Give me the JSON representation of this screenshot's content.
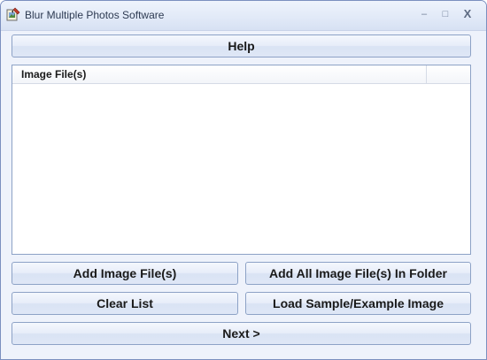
{
  "window": {
    "title": "Blur Multiple Photos Software",
    "icon": "app-photo-edit-icon",
    "controls": {
      "minimize": "–",
      "maximize": "□",
      "close": "X"
    }
  },
  "buttons": {
    "help": "Help",
    "add_files": "Add Image File(s)",
    "add_folder": "Add All Image File(s) In Folder",
    "clear_list": "Clear List",
    "load_sample": "Load Sample/Example Image",
    "next": "Next >"
  },
  "file_list": {
    "columns": [
      "Image File(s)"
    ],
    "rows": []
  }
}
